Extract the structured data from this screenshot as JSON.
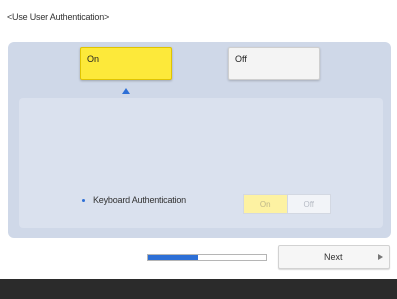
{
  "page_title": "<Use User Authentication>",
  "options": {
    "on_label": "On",
    "off_label": "Off",
    "selected": "On"
  },
  "keyboard_auth": {
    "label": "Keyboard Authentication",
    "on_label": "On",
    "off_label": "Off"
  },
  "progress": {
    "fraction": 0.42
  },
  "next_button": {
    "label": "Next"
  },
  "colors": {
    "accent": "#2d6fd6",
    "selected_yellow": "#fde93a",
    "panel": "#cfd8e8",
    "footer": "#2b2b2b"
  }
}
